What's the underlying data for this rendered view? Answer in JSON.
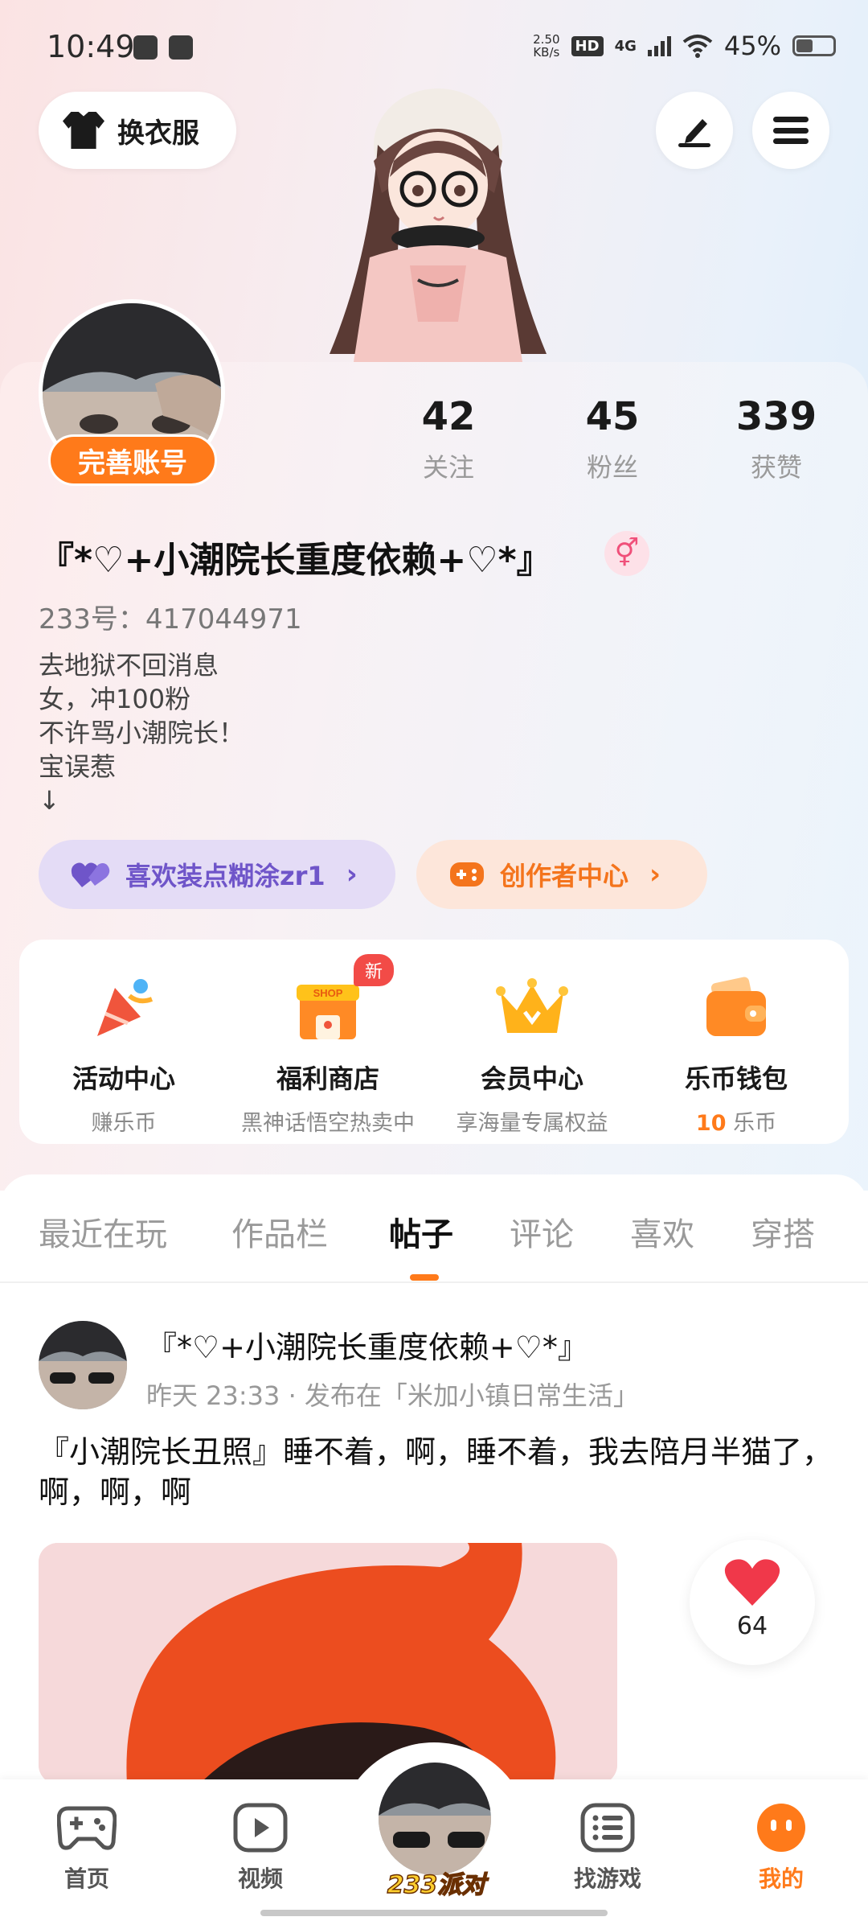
{
  "status_bar": {
    "time": "10:49",
    "net_speed_value": "2.50",
    "net_speed_unit": "KB/s",
    "hd": "HD",
    "network": "4G",
    "battery": "45%"
  },
  "top": {
    "outfit_label": "换衣服"
  },
  "profile": {
    "complete_account": "完善账号",
    "stats": [
      {
        "num": "42",
        "label": "关注"
      },
      {
        "num": "45",
        "label": "粉丝"
      },
      {
        "num": "339",
        "label": "获赞"
      }
    ],
    "nickname": "『*♡+小潮院长重度依赖+♡*』",
    "gender_symbol": "⚥",
    "uid": "233号：417044971",
    "bio": [
      "去地狱不回消息",
      "女，冲100粉",
      "不许骂小潮院长！",
      "宝误惹",
      "↓"
    ],
    "like_pill": "喜欢装点糊涂zr1",
    "creator_pill": "创作者中心",
    "chevron": "›"
  },
  "services": [
    {
      "title": "活动中心",
      "sub": "赚乐币"
    },
    {
      "title": "福利商店",
      "sub": "黑神话悟空热卖中",
      "badge": "新",
      "shop": "SHOP"
    },
    {
      "title": "会员中心",
      "sub": "享海量专属权益"
    },
    {
      "title": "乐币钱包",
      "sub_value": "10",
      "sub_unit": " 乐币"
    }
  ],
  "tabs": [
    "最近在玩",
    "作品栏",
    "帖子",
    "评论",
    "喜欢",
    "穿搭"
  ],
  "active_tab": "帖子",
  "post": {
    "author": "『*♡+小潮院长重度依赖+♡*』",
    "meta": "昨天 23:33 · 发布在「米加小镇日常生活」",
    "text": "『小潮院长丑照』睡不着，啊，睡不着，我去陪月半猫了，啊，啊，啊",
    "likes": "64"
  },
  "nav": {
    "home": "首页",
    "video": "视频",
    "party": "233派对",
    "find_games": "找游戏",
    "mine": "我的"
  },
  "colors": {
    "accent": "#ff7a1a",
    "purple": "#6f55c9",
    "heart": "#f0384a"
  }
}
